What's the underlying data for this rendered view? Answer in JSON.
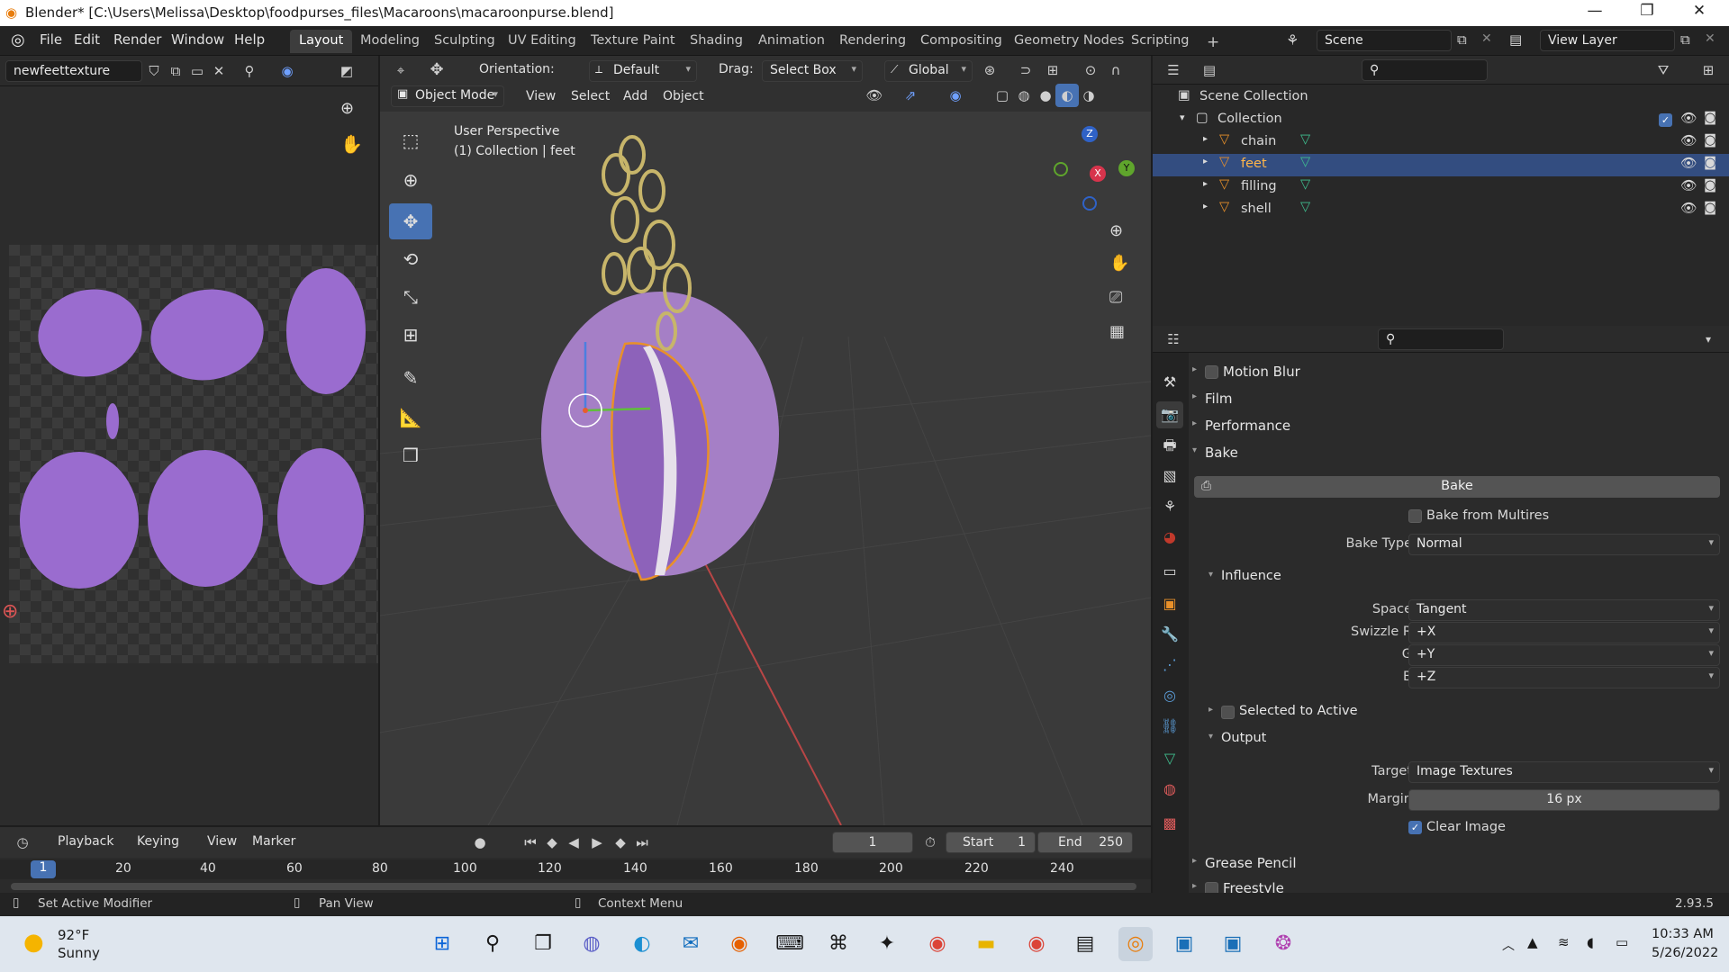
{
  "window": {
    "title": "Blender* [C:\\Users\\Melissa\\Desktop\\foodpurses_files\\Macaroons\\macaroonpurse.blend]",
    "minimize": "—",
    "maximize": "❐",
    "close": "✕"
  },
  "menu": [
    "File",
    "Edit",
    "Render",
    "Window",
    "Help"
  ],
  "workspaces": [
    "Layout",
    "Modeling",
    "Sculpting",
    "UV Editing",
    "Texture Paint",
    "Shading",
    "Animation",
    "Rendering",
    "Compositing",
    "Geometry Nodes",
    "Scripting"
  ],
  "active_workspace": "Layout",
  "add_workspace": "+",
  "scene": {
    "name": "Scene",
    "view_layer": "View Layer"
  },
  "image_editor": {
    "image_name": "newfeettexture"
  },
  "viewport_header": {
    "orientation_label": "Orientation:",
    "orientation": "Default",
    "drag_label": "Drag:",
    "drag": "Select Box",
    "transform": "Global",
    "mode": "Object Mode",
    "menus": [
      "View",
      "Select",
      "Add",
      "Object"
    ]
  },
  "viewport": {
    "perspective": "User Perspective",
    "context": "(1) Collection | feet",
    "gizmo": {
      "z": "Z",
      "y": "Y",
      "x": "X"
    }
  },
  "outliner": {
    "root": "Scene Collection",
    "collection": "Collection",
    "items": [
      {
        "name": "chain",
        "selected": false
      },
      {
        "name": "feet",
        "selected": true
      },
      {
        "name": "filling",
        "selected": false
      },
      {
        "name": "shell",
        "selected": false
      }
    ]
  },
  "properties": {
    "collapsed_panels": [
      "Motion Blur",
      "Film",
      "Performance"
    ],
    "bake": {
      "header": "Bake",
      "button": "Bake",
      "bake_from_multires": "Bake from Multires",
      "bake_type_label": "Bake Type",
      "bake_type": "Normal",
      "influence": {
        "header": "Influence",
        "space_label": "Space",
        "space": "Tangent",
        "swizzle_r_label": "Swizzle R",
        "swizzle_r": "+X",
        "g_label": "G",
        "g": "+Y",
        "b_label": "B",
        "b": "+Z"
      },
      "selected_to_active": "Selected to Active",
      "output": {
        "header": "Output",
        "target_label": "Target",
        "target": "Image Textures",
        "margin_label": "Margin",
        "margin": "16 px",
        "clear_image": "Clear Image",
        "clear_image_checked": true
      }
    },
    "bottom_panels": [
      "Grease Pencil",
      "Freestyle"
    ]
  },
  "timeline": {
    "menus": [
      "Playback",
      "Keying",
      "View",
      "Marker"
    ],
    "current_frame": "1",
    "start_label": "Start",
    "start": "1",
    "end_label": "End",
    "end": "250",
    "ruler": [
      "1",
      "20",
      "40",
      "60",
      "80",
      "100",
      "120",
      "140",
      "160",
      "180",
      "200",
      "220",
      "240"
    ]
  },
  "status": {
    "left": "Set Active Modifier",
    "middle": "Pan View",
    "right": "Context Menu",
    "version": "2.93.5"
  },
  "taskbar": {
    "weather_temp": "92°F",
    "weather_desc": "Sunny",
    "time": "10:33 AM",
    "date": "5/26/2022"
  },
  "colors": {
    "accent": "#4772b3",
    "selection_outline": "#e8902a",
    "macaron": "#a57fc6",
    "texture_islands": "#9a6ccf"
  }
}
